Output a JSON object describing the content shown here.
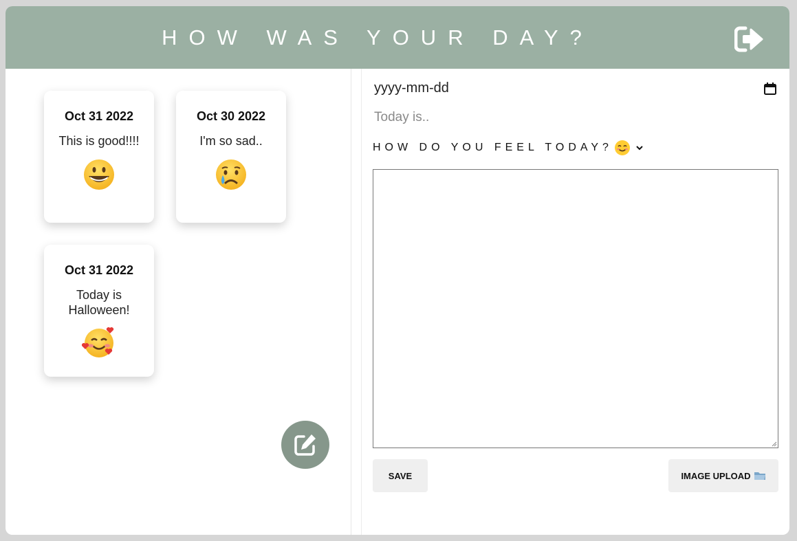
{
  "header": {
    "title": "HOW WAS YOUR DAY?",
    "logout_icon": "logout-icon"
  },
  "entries": [
    {
      "date": "Oct 31 2022",
      "text": "This is good!!!!",
      "emoji": "grinning-face"
    },
    {
      "date": "Oct 30 2022",
      "text": "I'm so sad..",
      "emoji": "crying-face"
    },
    {
      "date": "Oct 31 2022",
      "text": "Today is Halloween!",
      "emoji": "smiling-face-with-hearts"
    }
  ],
  "editor": {
    "date_placeholder": "yyyy-mm-dd",
    "title_placeholder": "Today is..",
    "mood_label": "HOW DO YOU FEEL TODAY?",
    "mood_emoji": "smiling-face-with-smiling-eyes",
    "save_label": "SAVE",
    "upload_label": "IMAGE UPLOAD"
  },
  "colors": {
    "header": "#9bb0a3",
    "fab": "#86978b",
    "background": "#d6d6d6"
  }
}
